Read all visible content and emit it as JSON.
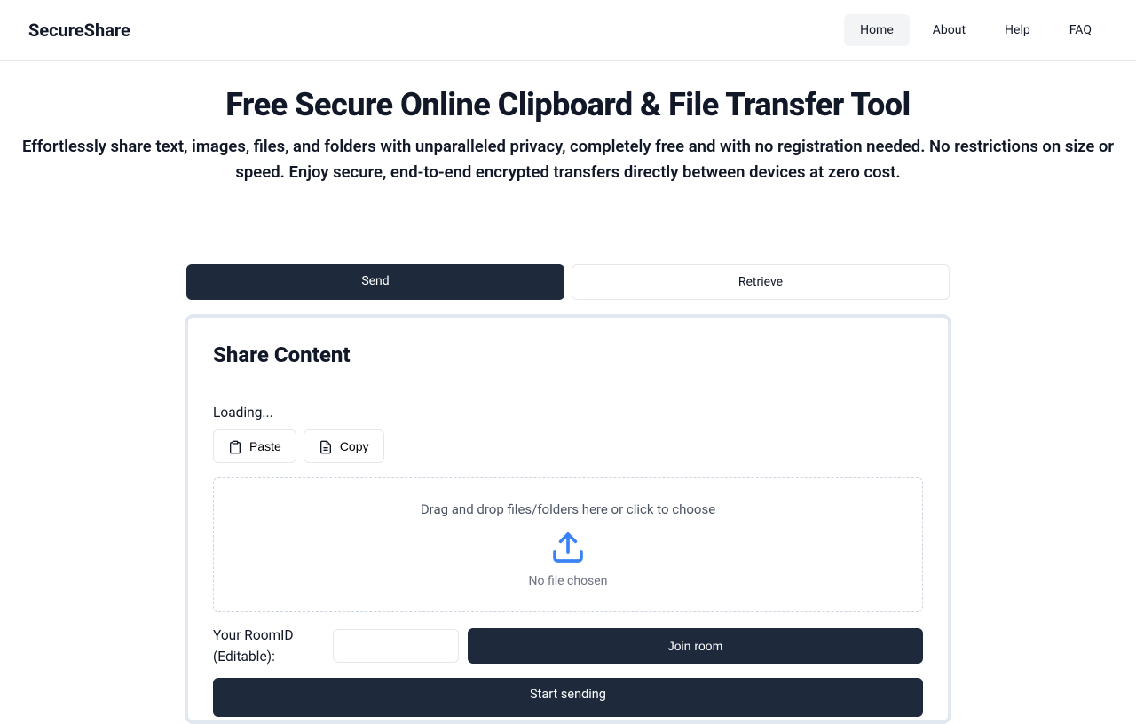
{
  "brand": "SecureShare",
  "nav": {
    "items": [
      {
        "label": "Home",
        "active": true
      },
      {
        "label": "About",
        "active": false
      },
      {
        "label": "Help",
        "active": false
      },
      {
        "label": "FAQ",
        "active": false
      }
    ]
  },
  "hero": {
    "title": "Free Secure Online Clipboard & File Transfer Tool",
    "subtitle": "Effortlessly share text, images, files, and folders with unparalleled privacy, completely free and with no registration needed. No restrictions on size or speed. Enjoy secure, end-to-end encrypted transfers directly between devices at zero cost."
  },
  "tabs": {
    "send": "Send",
    "retrieve": "Retrieve"
  },
  "card": {
    "title": "Share Content",
    "status": "Loading...",
    "paste_label": "Paste",
    "copy_label": "Copy",
    "dropzone_text": "Drag and drop files/folders here or click to choose",
    "no_file_text": "No file chosen",
    "room_label": "Your RoomID (Editable):",
    "room_value": "",
    "join_label": "Join room",
    "start_label": "Start sending"
  },
  "colors": {
    "dark": "#1e293b",
    "accent": "#3b82f6"
  }
}
